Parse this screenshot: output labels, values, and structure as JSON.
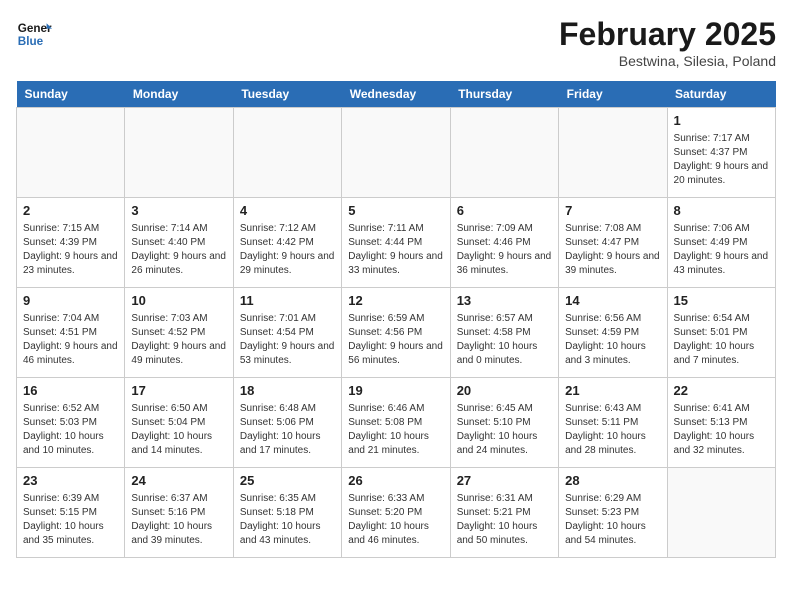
{
  "header": {
    "logo_line1": "General",
    "logo_line2": "Blue",
    "month": "February 2025",
    "location": "Bestwina, Silesia, Poland"
  },
  "weekdays": [
    "Sunday",
    "Monday",
    "Tuesday",
    "Wednesday",
    "Thursday",
    "Friday",
    "Saturday"
  ],
  "weeks": [
    [
      {
        "day": "",
        "info": ""
      },
      {
        "day": "",
        "info": ""
      },
      {
        "day": "",
        "info": ""
      },
      {
        "day": "",
        "info": ""
      },
      {
        "day": "",
        "info": ""
      },
      {
        "day": "",
        "info": ""
      },
      {
        "day": "1",
        "info": "Sunrise: 7:17 AM\nSunset: 4:37 PM\nDaylight: 9 hours and 20 minutes."
      }
    ],
    [
      {
        "day": "2",
        "info": "Sunrise: 7:15 AM\nSunset: 4:39 PM\nDaylight: 9 hours and 23 minutes."
      },
      {
        "day": "3",
        "info": "Sunrise: 7:14 AM\nSunset: 4:40 PM\nDaylight: 9 hours and 26 minutes."
      },
      {
        "day": "4",
        "info": "Sunrise: 7:12 AM\nSunset: 4:42 PM\nDaylight: 9 hours and 29 minutes."
      },
      {
        "day": "5",
        "info": "Sunrise: 7:11 AM\nSunset: 4:44 PM\nDaylight: 9 hours and 33 minutes."
      },
      {
        "day": "6",
        "info": "Sunrise: 7:09 AM\nSunset: 4:46 PM\nDaylight: 9 hours and 36 minutes."
      },
      {
        "day": "7",
        "info": "Sunrise: 7:08 AM\nSunset: 4:47 PM\nDaylight: 9 hours and 39 minutes."
      },
      {
        "day": "8",
        "info": "Sunrise: 7:06 AM\nSunset: 4:49 PM\nDaylight: 9 hours and 43 minutes."
      }
    ],
    [
      {
        "day": "9",
        "info": "Sunrise: 7:04 AM\nSunset: 4:51 PM\nDaylight: 9 hours and 46 minutes."
      },
      {
        "day": "10",
        "info": "Sunrise: 7:03 AM\nSunset: 4:52 PM\nDaylight: 9 hours and 49 minutes."
      },
      {
        "day": "11",
        "info": "Sunrise: 7:01 AM\nSunset: 4:54 PM\nDaylight: 9 hours and 53 minutes."
      },
      {
        "day": "12",
        "info": "Sunrise: 6:59 AM\nSunset: 4:56 PM\nDaylight: 9 hours and 56 minutes."
      },
      {
        "day": "13",
        "info": "Sunrise: 6:57 AM\nSunset: 4:58 PM\nDaylight: 10 hours and 0 minutes."
      },
      {
        "day": "14",
        "info": "Sunrise: 6:56 AM\nSunset: 4:59 PM\nDaylight: 10 hours and 3 minutes."
      },
      {
        "day": "15",
        "info": "Sunrise: 6:54 AM\nSunset: 5:01 PM\nDaylight: 10 hours and 7 minutes."
      }
    ],
    [
      {
        "day": "16",
        "info": "Sunrise: 6:52 AM\nSunset: 5:03 PM\nDaylight: 10 hours and 10 minutes."
      },
      {
        "day": "17",
        "info": "Sunrise: 6:50 AM\nSunset: 5:04 PM\nDaylight: 10 hours and 14 minutes."
      },
      {
        "day": "18",
        "info": "Sunrise: 6:48 AM\nSunset: 5:06 PM\nDaylight: 10 hours and 17 minutes."
      },
      {
        "day": "19",
        "info": "Sunrise: 6:46 AM\nSunset: 5:08 PM\nDaylight: 10 hours and 21 minutes."
      },
      {
        "day": "20",
        "info": "Sunrise: 6:45 AM\nSunset: 5:10 PM\nDaylight: 10 hours and 24 minutes."
      },
      {
        "day": "21",
        "info": "Sunrise: 6:43 AM\nSunset: 5:11 PM\nDaylight: 10 hours and 28 minutes."
      },
      {
        "day": "22",
        "info": "Sunrise: 6:41 AM\nSunset: 5:13 PM\nDaylight: 10 hours and 32 minutes."
      }
    ],
    [
      {
        "day": "23",
        "info": "Sunrise: 6:39 AM\nSunset: 5:15 PM\nDaylight: 10 hours and 35 minutes."
      },
      {
        "day": "24",
        "info": "Sunrise: 6:37 AM\nSunset: 5:16 PM\nDaylight: 10 hours and 39 minutes."
      },
      {
        "day": "25",
        "info": "Sunrise: 6:35 AM\nSunset: 5:18 PM\nDaylight: 10 hours and 43 minutes."
      },
      {
        "day": "26",
        "info": "Sunrise: 6:33 AM\nSunset: 5:20 PM\nDaylight: 10 hours and 46 minutes."
      },
      {
        "day": "27",
        "info": "Sunrise: 6:31 AM\nSunset: 5:21 PM\nDaylight: 10 hours and 50 minutes."
      },
      {
        "day": "28",
        "info": "Sunrise: 6:29 AM\nSunset: 5:23 PM\nDaylight: 10 hours and 54 minutes."
      },
      {
        "day": "",
        "info": ""
      }
    ]
  ]
}
